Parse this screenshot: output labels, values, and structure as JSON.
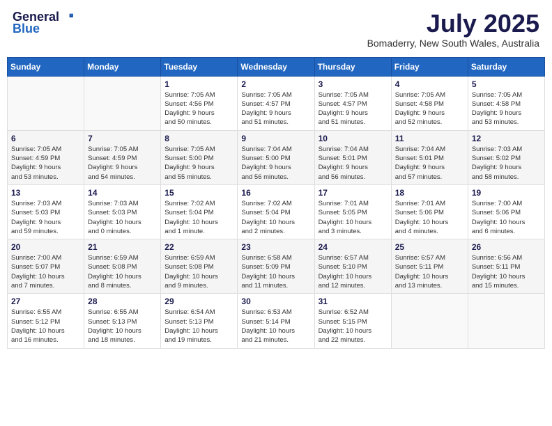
{
  "header": {
    "logo": {
      "general": "General",
      "blue": "Blue"
    },
    "month_title": "July 2025",
    "location": "Bomaderry, New South Wales, Australia"
  },
  "calendar": {
    "days_of_week": [
      "Sunday",
      "Monday",
      "Tuesday",
      "Wednesday",
      "Thursday",
      "Friday",
      "Saturday"
    ],
    "weeks": [
      [
        {
          "day": "",
          "info": ""
        },
        {
          "day": "",
          "info": ""
        },
        {
          "day": "1",
          "info": "Sunrise: 7:05 AM\nSunset: 4:56 PM\nDaylight: 9 hours\nand 50 minutes."
        },
        {
          "day": "2",
          "info": "Sunrise: 7:05 AM\nSunset: 4:57 PM\nDaylight: 9 hours\nand 51 minutes."
        },
        {
          "day": "3",
          "info": "Sunrise: 7:05 AM\nSunset: 4:57 PM\nDaylight: 9 hours\nand 51 minutes."
        },
        {
          "day": "4",
          "info": "Sunrise: 7:05 AM\nSunset: 4:58 PM\nDaylight: 9 hours\nand 52 minutes."
        },
        {
          "day": "5",
          "info": "Sunrise: 7:05 AM\nSunset: 4:58 PM\nDaylight: 9 hours\nand 53 minutes."
        }
      ],
      [
        {
          "day": "6",
          "info": "Sunrise: 7:05 AM\nSunset: 4:59 PM\nDaylight: 9 hours\nand 53 minutes."
        },
        {
          "day": "7",
          "info": "Sunrise: 7:05 AM\nSunset: 4:59 PM\nDaylight: 9 hours\nand 54 minutes."
        },
        {
          "day": "8",
          "info": "Sunrise: 7:05 AM\nSunset: 5:00 PM\nDaylight: 9 hours\nand 55 minutes."
        },
        {
          "day": "9",
          "info": "Sunrise: 7:04 AM\nSunset: 5:00 PM\nDaylight: 9 hours\nand 56 minutes."
        },
        {
          "day": "10",
          "info": "Sunrise: 7:04 AM\nSunset: 5:01 PM\nDaylight: 9 hours\nand 56 minutes."
        },
        {
          "day": "11",
          "info": "Sunrise: 7:04 AM\nSunset: 5:01 PM\nDaylight: 9 hours\nand 57 minutes."
        },
        {
          "day": "12",
          "info": "Sunrise: 7:03 AM\nSunset: 5:02 PM\nDaylight: 9 hours\nand 58 minutes."
        }
      ],
      [
        {
          "day": "13",
          "info": "Sunrise: 7:03 AM\nSunset: 5:03 PM\nDaylight: 9 hours\nand 59 minutes."
        },
        {
          "day": "14",
          "info": "Sunrise: 7:03 AM\nSunset: 5:03 PM\nDaylight: 10 hours\nand 0 minutes."
        },
        {
          "day": "15",
          "info": "Sunrise: 7:02 AM\nSunset: 5:04 PM\nDaylight: 10 hours\nand 1 minute."
        },
        {
          "day": "16",
          "info": "Sunrise: 7:02 AM\nSunset: 5:04 PM\nDaylight: 10 hours\nand 2 minutes."
        },
        {
          "day": "17",
          "info": "Sunrise: 7:01 AM\nSunset: 5:05 PM\nDaylight: 10 hours\nand 3 minutes."
        },
        {
          "day": "18",
          "info": "Sunrise: 7:01 AM\nSunset: 5:06 PM\nDaylight: 10 hours\nand 4 minutes."
        },
        {
          "day": "19",
          "info": "Sunrise: 7:00 AM\nSunset: 5:06 PM\nDaylight: 10 hours\nand 6 minutes."
        }
      ],
      [
        {
          "day": "20",
          "info": "Sunrise: 7:00 AM\nSunset: 5:07 PM\nDaylight: 10 hours\nand 7 minutes."
        },
        {
          "day": "21",
          "info": "Sunrise: 6:59 AM\nSunset: 5:08 PM\nDaylight: 10 hours\nand 8 minutes."
        },
        {
          "day": "22",
          "info": "Sunrise: 6:59 AM\nSunset: 5:08 PM\nDaylight: 10 hours\nand 9 minutes."
        },
        {
          "day": "23",
          "info": "Sunrise: 6:58 AM\nSunset: 5:09 PM\nDaylight: 10 hours\nand 11 minutes."
        },
        {
          "day": "24",
          "info": "Sunrise: 6:57 AM\nSunset: 5:10 PM\nDaylight: 10 hours\nand 12 minutes."
        },
        {
          "day": "25",
          "info": "Sunrise: 6:57 AM\nSunset: 5:11 PM\nDaylight: 10 hours\nand 13 minutes."
        },
        {
          "day": "26",
          "info": "Sunrise: 6:56 AM\nSunset: 5:11 PM\nDaylight: 10 hours\nand 15 minutes."
        }
      ],
      [
        {
          "day": "27",
          "info": "Sunrise: 6:55 AM\nSunset: 5:12 PM\nDaylight: 10 hours\nand 16 minutes."
        },
        {
          "day": "28",
          "info": "Sunrise: 6:55 AM\nSunset: 5:13 PM\nDaylight: 10 hours\nand 18 minutes."
        },
        {
          "day": "29",
          "info": "Sunrise: 6:54 AM\nSunset: 5:13 PM\nDaylight: 10 hours\nand 19 minutes."
        },
        {
          "day": "30",
          "info": "Sunrise: 6:53 AM\nSunset: 5:14 PM\nDaylight: 10 hours\nand 21 minutes."
        },
        {
          "day": "31",
          "info": "Sunrise: 6:52 AM\nSunset: 5:15 PM\nDaylight: 10 hours\nand 22 minutes."
        },
        {
          "day": "",
          "info": ""
        },
        {
          "day": "",
          "info": ""
        }
      ]
    ]
  }
}
